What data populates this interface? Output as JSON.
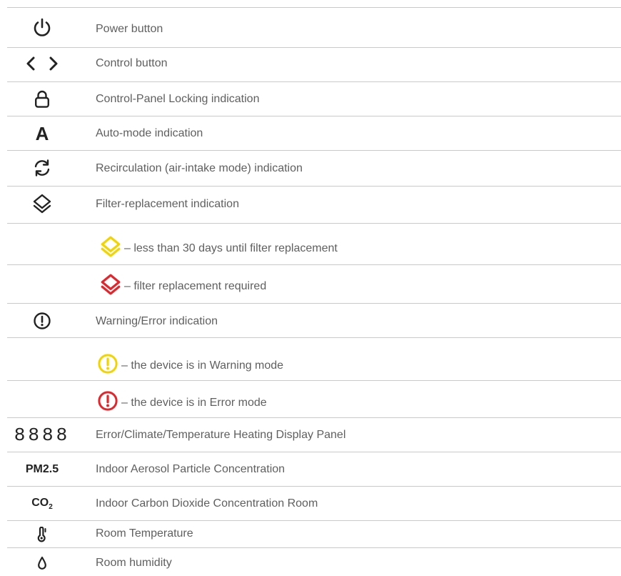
{
  "rows": [
    {
      "icon": "power-icon",
      "label": "Power button"
    },
    {
      "icon": "chevrons-left-right-icon",
      "label": "Control button"
    },
    {
      "icon": "lock-icon",
      "label": "Control-Panel Locking indication"
    },
    {
      "icon": "auto-mode-a-icon",
      "icon_text": "A",
      "label": "Auto-mode indication"
    },
    {
      "icon": "recirculation-icon",
      "label": "Recirculation (air-intake mode) indication"
    },
    {
      "icon": "filter-layers-icon",
      "label": "Filter-replacement indication"
    },
    {
      "icon": "filter-layers-yellow-icon",
      "label": "– less than 30 days until filter replacement"
    },
    {
      "icon": "filter-layers-red-icon",
      "label": "– filter replacement required"
    },
    {
      "icon": "warning-icon",
      "label": "Warning/Error indication"
    },
    {
      "icon": "warning-yellow-icon",
      "label": "– the device is in Warning mode"
    },
    {
      "icon": "error-red-icon",
      "label": "– the device is in Error mode"
    },
    {
      "icon": "seven-segment-display-icon",
      "icon_text": "8888",
      "label": "Error/Climate/Temperature Heating Display Panel"
    },
    {
      "icon": "pm25-text-icon",
      "icon_text": "PM2.5",
      "label": "Indoor Aerosol Particle Concentration"
    },
    {
      "icon": "co2-text-icon",
      "icon_text": "CO",
      "icon_sub": "2",
      "label": "Indoor Carbon Dioxide Concentration Room"
    },
    {
      "icon": "thermometer-icon",
      "label": "Room Temperature"
    },
    {
      "icon": "water-drop-icon",
      "label": "Room humidity"
    }
  ],
  "colors": {
    "yellow": "#f2d400",
    "red": "#e3262c",
    "dark": "#222222",
    "line": "#c9c9c9",
    "text": "#5f5f5f"
  }
}
